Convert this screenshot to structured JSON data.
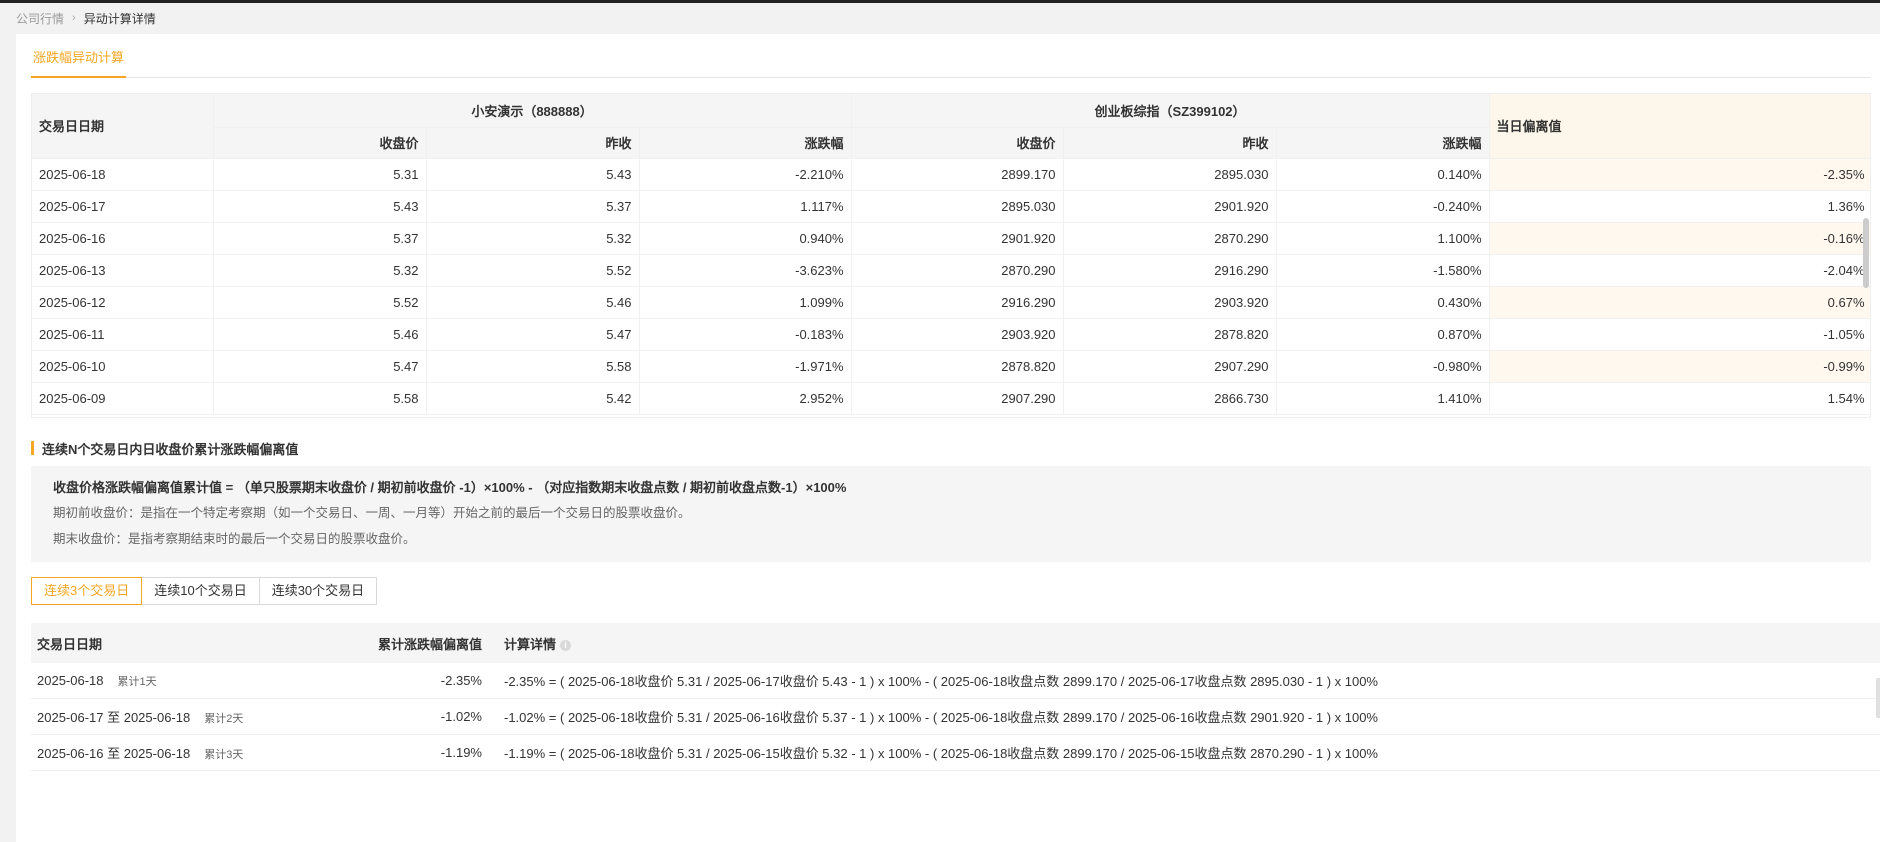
{
  "breadcrumb": {
    "parent": "公司行情",
    "current": "异动计算详情"
  },
  "tabs": {
    "active": "涨跌幅异动计算"
  },
  "main_table": {
    "date_header": "交易日日期",
    "stock_header": "小安演示（888888）",
    "index_header": "创业板综指（SZ399102）",
    "deviation_header": "当日偏离值",
    "sub_headers": [
      "收盘价",
      "昨收",
      "涨跌幅",
      "收盘价",
      "昨收",
      "涨跌幅"
    ],
    "rows": [
      {
        "date": "2025-06-18",
        "s_close": "5.31",
        "s_prev": "5.43",
        "s_chg": "-2.210%",
        "i_close": "2899.170",
        "i_prev": "2895.030",
        "i_chg": "0.140%",
        "dev": "-2.35%"
      },
      {
        "date": "2025-06-17",
        "s_close": "5.43",
        "s_prev": "5.37",
        "s_chg": "1.117%",
        "i_close": "2895.030",
        "i_prev": "2901.920",
        "i_chg": "-0.240%",
        "dev": "1.36%"
      },
      {
        "date": "2025-06-16",
        "s_close": "5.37",
        "s_prev": "5.32",
        "s_chg": "0.940%",
        "i_close": "2901.920",
        "i_prev": "2870.290",
        "i_chg": "1.100%",
        "dev": "-0.16%"
      },
      {
        "date": "2025-06-13",
        "s_close": "5.32",
        "s_prev": "5.52",
        "s_chg": "-3.623%",
        "i_close": "2870.290",
        "i_prev": "2916.290",
        "i_chg": "-1.580%",
        "dev": "-2.04%"
      },
      {
        "date": "2025-06-12",
        "s_close": "5.52",
        "s_prev": "5.46",
        "s_chg": "1.099%",
        "i_close": "2916.290",
        "i_prev": "2903.920",
        "i_chg": "0.430%",
        "dev": "0.67%"
      },
      {
        "date": "2025-06-11",
        "s_close": "5.46",
        "s_prev": "5.47",
        "s_chg": "-0.183%",
        "i_close": "2903.920",
        "i_prev": "2878.820",
        "i_chg": "0.870%",
        "dev": "-1.05%"
      },
      {
        "date": "2025-06-10",
        "s_close": "5.47",
        "s_prev": "5.58",
        "s_chg": "-1.971%",
        "i_close": "2878.820",
        "i_prev": "2907.290",
        "i_chg": "-0.980%",
        "dev": "-0.99%"
      },
      {
        "date": "2025-06-09",
        "s_close": "5.58",
        "s_prev": "5.42",
        "s_chg": "2.952%",
        "i_close": "2907.290",
        "i_prev": "2866.730",
        "i_chg": "1.410%",
        "dev": "1.54%"
      }
    ]
  },
  "section": {
    "title": "连续N个交易日内日收盘价累计涨跌幅偏离值"
  },
  "formula": {
    "main": "收盘价格涨跌幅偏离值累计值 = （单只股票期末收盘价 / 期初前收盘价 -1）×100%  -  （对应指数期末收盘点数 / 期初前收盘点数-1）×100%",
    "line1": "期初前收盘价：是指在一个特定考察期（如一个交易日、一周、一月等）开始之前的最后一个交易日的股票收盘价。",
    "line2": "期末收盘价：是指考察期结束时的最后一个交易日的股票收盘价。"
  },
  "buttons": {
    "b3": "连续3个交易日",
    "b10": "连续10个交易日",
    "b30": "连续30个交易日"
  },
  "detail": {
    "headers": {
      "date": "交易日日期",
      "dev": "累计涨跌幅偏离值",
      "calc": "计算详情"
    },
    "rows": [
      {
        "date": "2025-06-18",
        "acc": "累计1天",
        "dev": "-2.35%",
        "calc": "-2.35% = ( 2025-06-18收盘价 5.31 / 2025-06-17收盘价 5.43 - 1 ) x 100% - ( 2025-06-18收盘点数 2899.170 / 2025-06-17收盘点数 2895.030 - 1 ) x 100%"
      },
      {
        "date": "2025-06-17 至 2025-06-18",
        "acc": "累计2天",
        "dev": "-1.02%",
        "calc": "-1.02% = ( 2025-06-18收盘价 5.31 / 2025-06-16收盘价 5.37 - 1 ) x 100% - ( 2025-06-18收盘点数 2899.170 / 2025-06-16收盘点数 2901.920 - 1 ) x 100%"
      },
      {
        "date": "2025-06-16 至 2025-06-18",
        "acc": "累计3天",
        "dev": "-1.19%",
        "calc": "-1.19% = ( 2025-06-18收盘价 5.31 / 2025-06-15收盘价 5.32 - 1 ) x 100% - ( 2025-06-18收盘点数 2899.170 / 2025-06-15收盘点数 2870.290 - 1 ) x 100%"
      }
    ]
  },
  "colors": {
    "accent": "#f5a623",
    "header_bg": "#f5f5f5",
    "deviation_bg": "#fff8ee"
  }
}
